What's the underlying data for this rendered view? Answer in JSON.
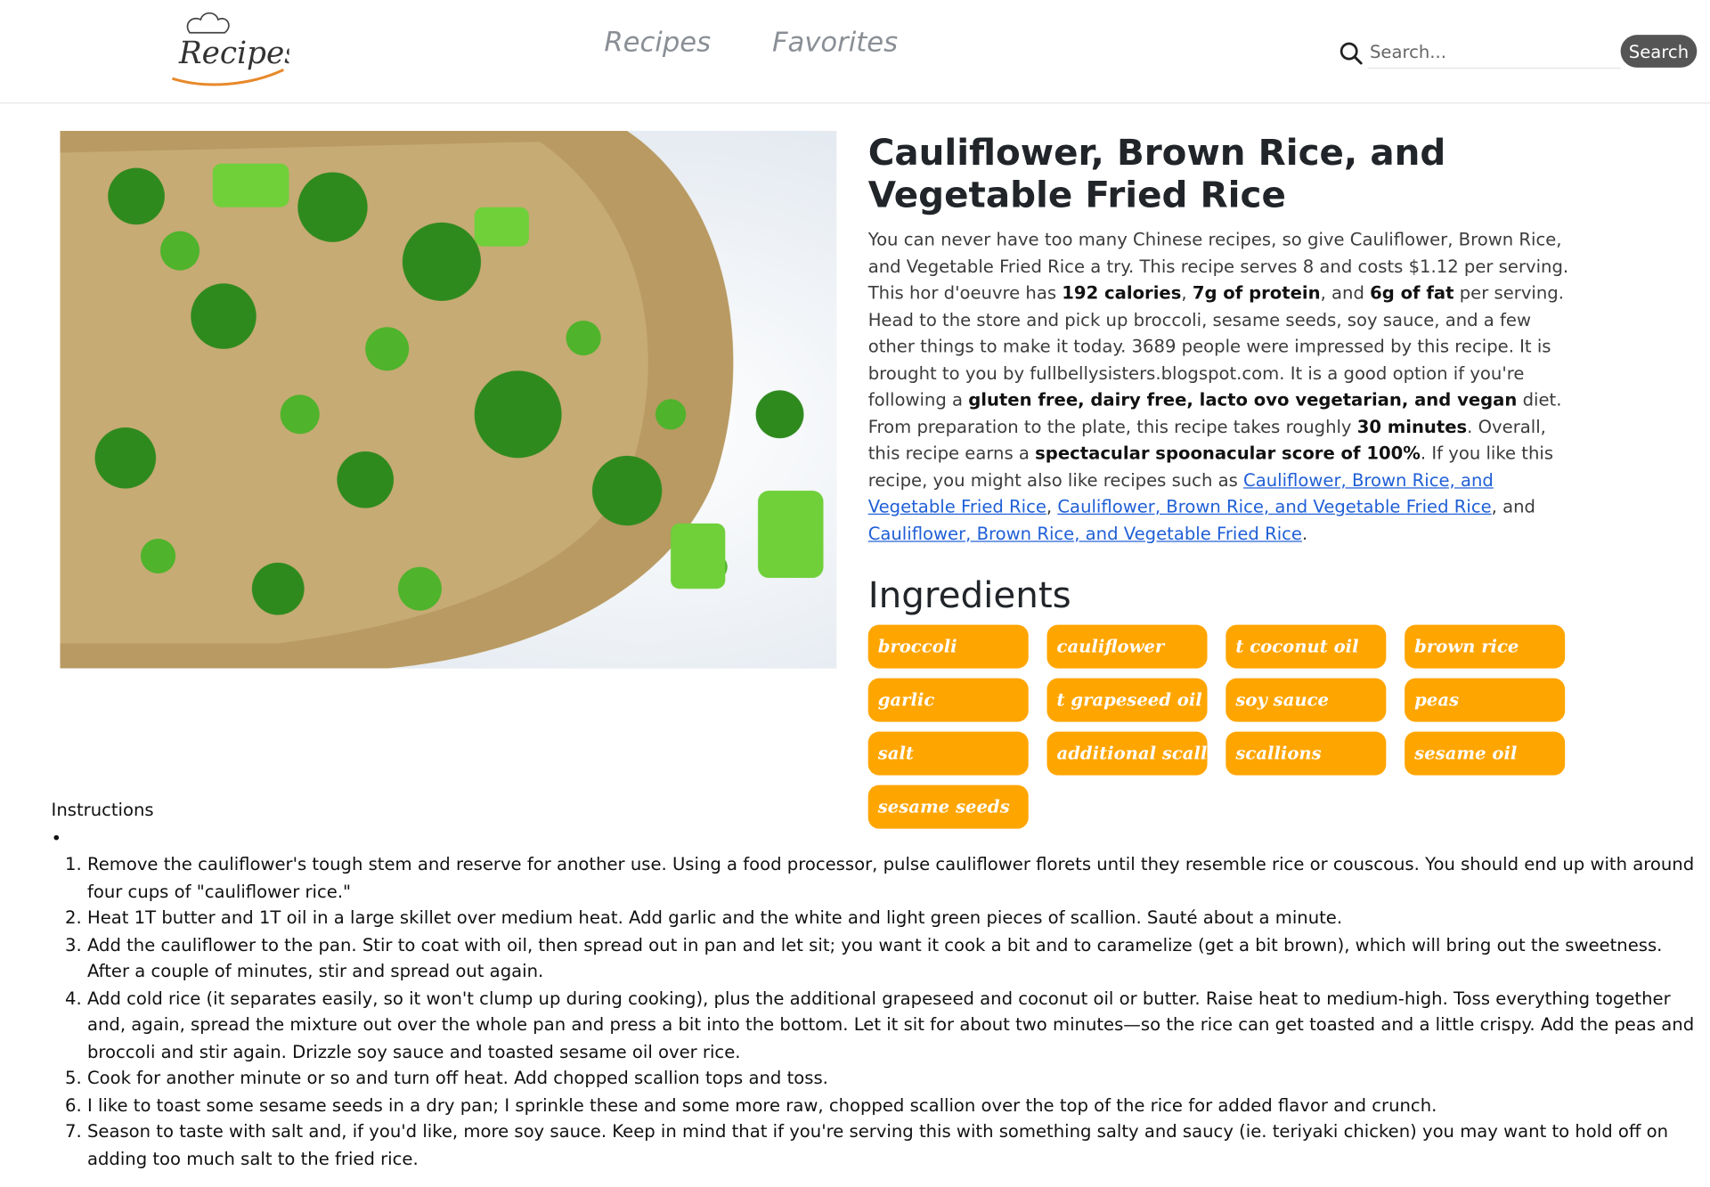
{
  "nav": {
    "logo_text": "Recipes",
    "links": [
      "Recipes",
      "Favorites"
    ],
    "search_placeholder": "Search...",
    "search_button": "Search",
    "search_icon": "search-icon"
  },
  "recipe": {
    "title": "Cauliflower, Brown Rice, and Vegetable Fried Rice",
    "summary": {
      "p1": "You can never have too many Chinese recipes, so give Cauliflower, Brown Rice, and Vegetable Fried Rice a try. This recipe serves 8 and costs $1.12 per serving. This hor d'oeuvre has ",
      "b1": "192 calories",
      "p2": ", ",
      "b2": "7g of protein",
      "p3": ", and ",
      "b3": "6g of fat",
      "p4": " per serving. Head to the store and pick up broccoli, sesame seeds, soy sauce, and a few other things to make it today. 3689 people were impressed by this recipe. It is brought to you by fullbellysisters.blogspot.com. It is a good option if you're following a ",
      "b4": "gluten free, dairy free, lacto ovo vegetarian, and vegan",
      "p5": " diet. From preparation to the plate, this recipe takes roughly ",
      "b5": "30 minutes",
      "p6": ". Overall, this recipe earns a ",
      "b6": "spectacular spoonacular score of 100%",
      "p7": ". If you like this recipe, you might also like recipes such as ",
      "link1": "Cauliflower, Brown Rice, and Vegetable Fried Rice",
      "p8": ", ",
      "link2": "Cauliflower, Brown Rice, and Vegetable Fried Rice",
      "p9": ", and ",
      "link3": "Cauliflower, Brown Rice, and Vegetable Fried Rice",
      "p10": "."
    },
    "ingredients_heading": "Ingredients",
    "ingredients": [
      "broccoli",
      "cauliflower",
      "t coconut oil",
      "brown rice",
      "garlic",
      "t grapeseed oil",
      "soy sauce",
      "peas",
      "salt",
      "additional scallion",
      "scallions",
      "sesame oil",
      "sesame seeds"
    ],
    "ingredient_color": "#ffa500"
  },
  "instructions": {
    "label": "Instructions",
    "steps": [
      "Remove the cauliflower's tough stem and reserve for another use. Using a food processor, pulse cauliflower florets until they resemble rice or couscous. You should end up with around four cups of \"cauliflower rice.\"",
      "Heat 1T butter and 1T oil in a large skillet over medium heat. Add garlic and the white and light green pieces of scallion. Sauté about a minute.",
      "Add the cauliflower to the pan. Stir to coat with oil, then spread out in pan and let sit; you want it cook a bit and to caramelize (get a bit brown), which will bring out the sweetness. After a couple of minutes, stir and spread out again.",
      "Add cold rice (it separates easily, so it won't clump up during cooking), plus the additional grapeseed and coconut oil or butter. Raise heat to medium-high. Toss everything together and, again, spread the mixture out over the whole pan and press a bit into the bottom. Let it sit for about two minutes—so the rice can get toasted and a little crispy. Add the peas and broccoli and stir again. Drizzle soy sauce and toasted sesame oil over rice.",
      "Cook for another minute or so and turn off heat. Add chopped scallion tops and toss.",
      "I like to toast some sesame seeds in a dry pan; I sprinkle these and some more raw, chopped scallion over the top of the rice for added flavor and crunch.",
      "Season to taste with salt and, if you'd like, more soy sauce. Keep in mind that if you're serving this with something salty and saucy (ie. teriyaki chicken) you may want to hold off on adding too much salt to the fried rice."
    ]
  }
}
